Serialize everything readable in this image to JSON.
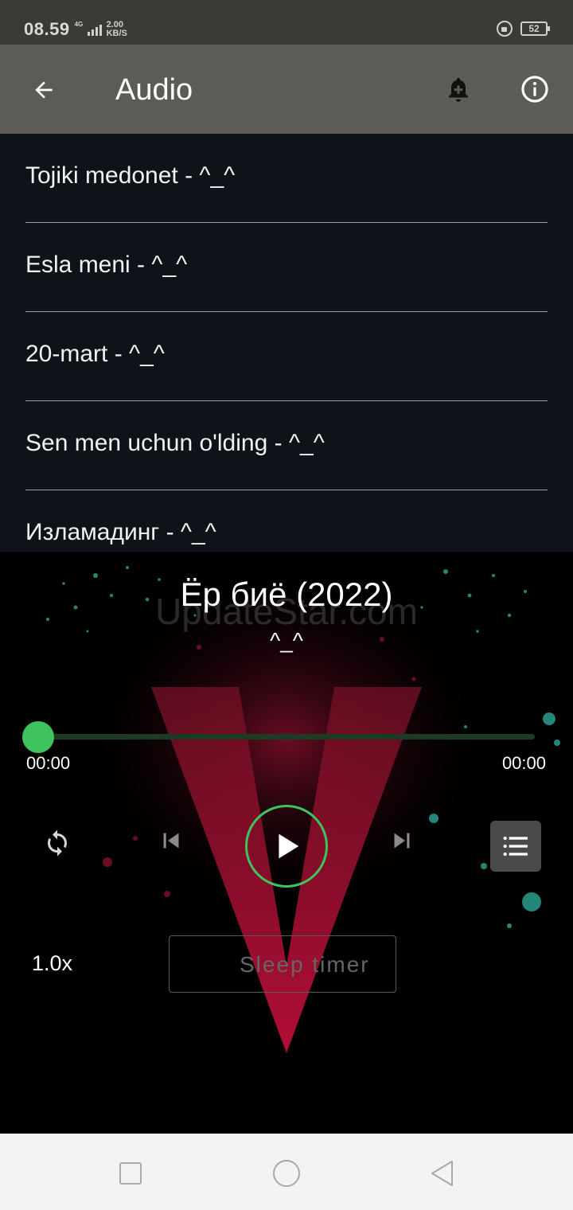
{
  "status_bar": {
    "time": "08.59",
    "network": "4G",
    "speed_value": "2.00",
    "speed_unit": "KB/S",
    "battery": "52",
    "icons": [
      "network-signal-icon",
      "rotation-lock-icon",
      "battery-icon"
    ]
  },
  "app_bar": {
    "title": "Audio",
    "icons": [
      "back-arrow-icon",
      "alarm-add-icon",
      "info-icon"
    ]
  },
  "tracks": [
    "Tojiki medonet - ^_^",
    "Esla meni - ^_^",
    "20-mart - ^_^",
    "Sen men uchun o'lding - ^_^",
    "Изламадинг - ^_^"
  ],
  "player": {
    "title": "Ёр биё (2022)",
    "watermark": "UpdateStar.com",
    "artist": "^_^",
    "current_time": "00:00",
    "total_time": "00:00",
    "progress": 0,
    "playback_speed": "1.0x",
    "sleep_timer_label": "Sleep timer",
    "accent_color": "#3fc35e",
    "icons": [
      "repeat-icon",
      "skip-previous-icon",
      "play-icon",
      "skip-next-icon",
      "queue-list-icon",
      "moon-icon"
    ]
  },
  "nav_bar": {
    "icons": [
      "recent-apps-icon",
      "home-icon",
      "back-icon"
    ]
  }
}
